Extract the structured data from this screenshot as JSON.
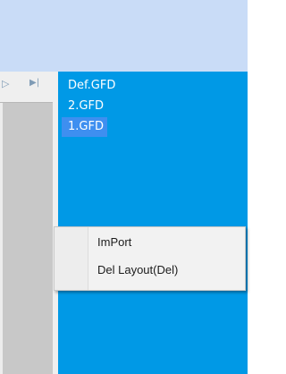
{
  "left_pane": {
    "nav_prev_glyph": "▷",
    "nav_last_glyph": "▶|"
  },
  "layout_list": {
    "items": [
      {
        "label": "Def.GFD",
        "selected": false
      },
      {
        "label": "2.GFD",
        "selected": false
      },
      {
        "label": "1.GFD",
        "selected": true
      }
    ]
  },
  "context_menu": {
    "items": [
      {
        "label": "ImPort"
      },
      {
        "label": "Del Layout(Del)"
      }
    ]
  },
  "colors": {
    "title_bar": "#c9dcf7",
    "list_background": "#0099e6",
    "selection": "#3e8ff0",
    "left_pane": "#c8c8c8",
    "menu_background": "#f2f2f2"
  }
}
